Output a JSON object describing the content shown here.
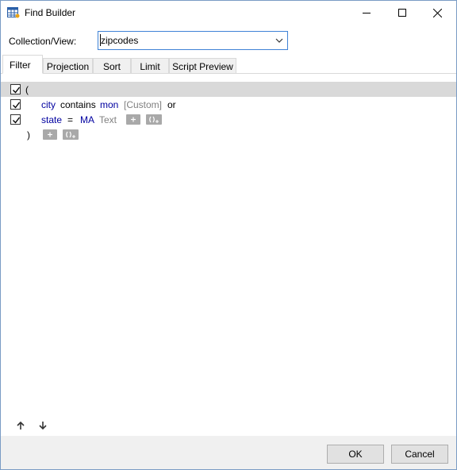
{
  "window": {
    "title": "Find Builder"
  },
  "collection": {
    "label": "Collection/View:",
    "value": "zipcodes"
  },
  "tabs": [
    {
      "label": "Filter",
      "active": true
    },
    {
      "label": "Projection",
      "active": false
    },
    {
      "label": "Sort",
      "active": false
    },
    {
      "label": "Limit",
      "active": false
    },
    {
      "label": "Script Preview",
      "active": false
    }
  ],
  "filter": {
    "group_open": "(",
    "group_close": ")",
    "conditions": [
      {
        "field": "city",
        "operator": "contains",
        "value": "mon",
        "type": "[Custom]",
        "conjunction": "or",
        "checked": true
      },
      {
        "field": "state",
        "operator": "=",
        "value": "MA",
        "type": "Text",
        "checked": true
      }
    ]
  },
  "icons": {
    "app": "table-window-icon",
    "minimize": "minimize-icon",
    "maximize": "maximize-icon",
    "close": "close-icon",
    "dropdown": "chevron-down-icon",
    "add": "plus-icon",
    "add_group": "add-group-icon",
    "move_up": "arrow-up-icon",
    "move_down": "arrow-down-icon"
  },
  "buttons": {
    "ok": "OK",
    "cancel": "Cancel"
  },
  "colors": {
    "field": "#0000a0",
    "muted": "#808080",
    "selected_row": "#d9d9d9",
    "mini_button": "#a9a9a9"
  }
}
